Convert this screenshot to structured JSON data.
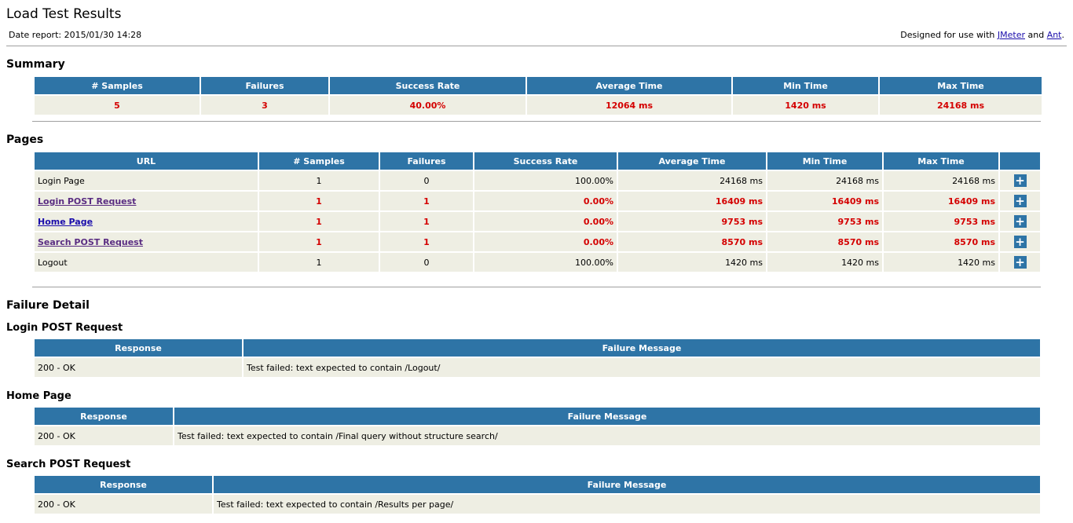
{
  "report": {
    "title": "Load Test Results",
    "date_label": "Date report: 2015/01/30 14:28",
    "designed_prefix": "Designed for use with",
    "designed_link1": "JMeter",
    "designed_mid": "and",
    "designed_link2": "Ant",
    "designed_suffix": "."
  },
  "summary": {
    "heading": "Summary",
    "headers": [
      "# Samples",
      "Failures",
      "Success Rate",
      "Average Time",
      "Min Time",
      "Max Time"
    ],
    "values": [
      "5",
      "3",
      "40.00%",
      "12064 ms",
      "1420 ms",
      "24168 ms"
    ]
  },
  "pages": {
    "heading": "Pages",
    "headers": [
      "URL",
      "# Samples",
      "Failures",
      "Success Rate",
      "Average Time",
      "Min Time",
      "Max Time"
    ],
    "expand_glyph": "+",
    "rows": [
      {
        "url": "Login Page",
        "samples": "1",
        "failures": "0",
        "success_rate": "100.00%",
        "avg": "24168 ms",
        "min": "24168 ms",
        "max": "24168 ms",
        "failed": false
      },
      {
        "url": "Login POST Request",
        "samples": "1",
        "failures": "1",
        "success_rate": "0.00%",
        "avg": "16409 ms",
        "min": "16409 ms",
        "max": "16409 ms",
        "failed": true
      },
      {
        "url": "Home Page",
        "samples": "1",
        "failures": "1",
        "success_rate": "0.00%",
        "avg": "9753 ms",
        "min": "9753 ms",
        "max": "9753 ms",
        "failed": true
      },
      {
        "url": "Search POST Request",
        "samples": "1",
        "failures": "1",
        "success_rate": "0.00%",
        "avg": "8570 ms",
        "min": "8570 ms",
        "max": "8570 ms",
        "failed": true
      },
      {
        "url": "Logout",
        "samples": "1",
        "failures": "0",
        "success_rate": "100.00%",
        "avg": "1420 ms",
        "min": "1420 ms",
        "max": "1420 ms",
        "failed": false
      }
    ]
  },
  "failure_detail": {
    "heading": "Failure Detail",
    "response_header": "Response",
    "message_header": "Failure Message",
    "groups": [
      {
        "title": "Login POST Request",
        "response": "200 - OK",
        "message": "Test failed: text expected to contain /Logout/"
      },
      {
        "title": "Home Page",
        "response": "200 - OK",
        "message": "Test failed: text expected to contain /Final query without structure search/"
      },
      {
        "title": "Search POST Request",
        "response": "200 - OK",
        "message": "Test failed: text expected to contain /Results per page/"
      }
    ]
  },
  "colors": {
    "header_bg": "#2e74a6",
    "cell_bg": "#eeeee3",
    "fail_text": "#d40000",
    "link": "#1a0dab",
    "visited_link": "#5a2d82"
  }
}
